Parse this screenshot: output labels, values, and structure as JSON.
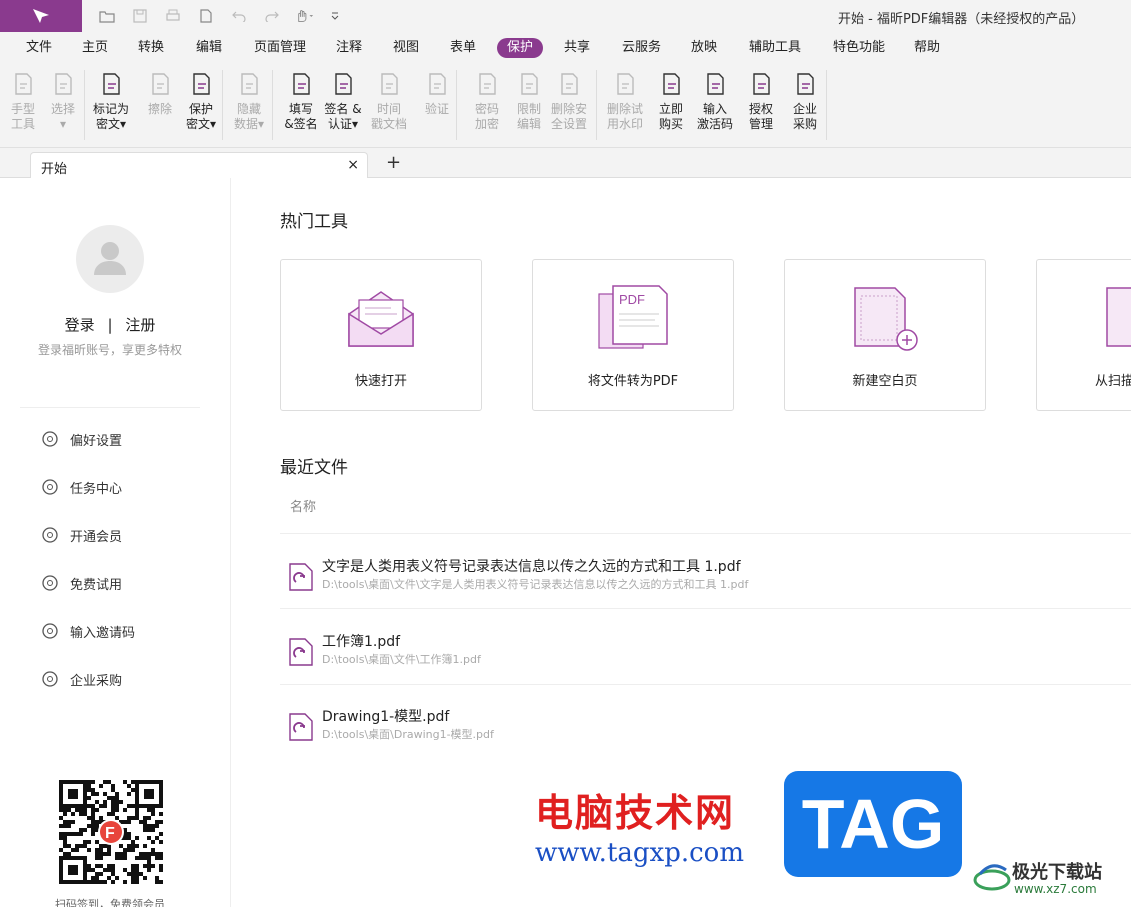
{
  "window": {
    "title": "开始 - 福昕PDF编辑器（未经授权的产品）"
  },
  "menu": [
    "文件",
    "主页",
    "转换",
    "编辑",
    "页面管理",
    "注释",
    "视图",
    "表单",
    "保护",
    "共享",
    "云服务",
    "放映",
    "辅助工具",
    "特色功能",
    "帮助"
  ],
  "menu_active": "保护",
  "ribbon": [
    {
      "label": "手型\n工具",
      "icon": "hand-icon",
      "enabled": false
    },
    {
      "label": "选择\n▾",
      "icon": "select-cursor-icon",
      "enabled": false
    },
    {
      "label": "标记为\n密文▾",
      "icon": "mark-redact-icon",
      "enabled": true
    },
    {
      "label": "擦除",
      "icon": "erase-icon",
      "enabled": false
    },
    {
      "label": "保护\n密文▾",
      "icon": "protect-redact-icon",
      "enabled": true
    },
    {
      "label": "隐藏\n数据▾",
      "icon": "hide-data-icon",
      "enabled": false
    },
    {
      "label": "填写\n&签名",
      "icon": "fill-sign-icon",
      "enabled": true
    },
    {
      "label": "签名 &\n认证▾",
      "icon": "sign-certify-icon",
      "enabled": true
    },
    {
      "label": "时间\n戳文档",
      "icon": "timestamp-icon",
      "enabled": false
    },
    {
      "label": "验证",
      "icon": "validate-icon",
      "enabled": false
    },
    {
      "label": "密码\n加密",
      "icon": "password-lock-icon",
      "enabled": false
    },
    {
      "label": "限制\n编辑",
      "icon": "restrict-edit-icon",
      "enabled": false
    },
    {
      "label": "删除安\n全设置",
      "icon": "remove-security-icon",
      "enabled": false
    },
    {
      "label": "删除试\n用水印",
      "icon": "remove-watermark-icon",
      "enabled": false
    },
    {
      "label": "立即\n购买",
      "icon": "cart-icon",
      "enabled": true
    },
    {
      "label": "输入\n激活码",
      "icon": "activation-key-icon",
      "enabled": true
    },
    {
      "label": "授权\n管理",
      "icon": "license-icon",
      "enabled": true
    },
    {
      "label": "企业\n采购",
      "icon": "bag-icon",
      "enabled": true
    }
  ],
  "tab": {
    "title": "开始",
    "close": "×",
    "add": "+"
  },
  "user": {
    "login": "登录",
    "sep": "|",
    "register": "注册",
    "subtitle": "登录福昕账号，享更多特权"
  },
  "sidebar": [
    {
      "label": "偏好设置",
      "icon": "preferences-icon"
    },
    {
      "label": "任务中心",
      "icon": "task-center-icon"
    },
    {
      "label": "开通会员",
      "icon": "membership-icon"
    },
    {
      "label": "免费试用",
      "icon": "free-trial-icon"
    },
    {
      "label": "输入邀请码",
      "icon": "invite-code-icon"
    },
    {
      "label": "企业采购",
      "icon": "enterprise-purchase-icon"
    }
  ],
  "qr_caption": "扫码签到，免费领会员",
  "hot_tools": {
    "title": "热门工具",
    "items": [
      {
        "label": "快速打开",
        "icon": "envelope-open-icon"
      },
      {
        "label": "将文件转为PDF",
        "icon": "convert-pdf-icon"
      },
      {
        "label": "新建空白页",
        "icon": "new-blank-page-icon"
      },
      {
        "label": "从扫描",
        "icon": "scan-icon"
      }
    ]
  },
  "recent": {
    "title": "最近文件",
    "column": "名称",
    "files": [
      {
        "name": "文字是人类用表义符号记录表达信息以传之久远的方式和工具 1.pdf",
        "path": "D:\\tools\\桌面\\文件\\文字是人类用表义符号记录表达信息以传之久远的方式和工具 1.pdf"
      },
      {
        "name": "工作簿1.pdf",
        "path": "D:\\tools\\桌面\\文件\\工作簿1.pdf"
      },
      {
        "name": "Drawing1-模型.pdf",
        "path": "D:\\tools\\桌面\\Drawing1-模型.pdf"
      }
    ]
  },
  "watermark": {
    "cn": "电脑技术网",
    "url": "www.tagxp.com",
    "tag": "TAG",
    "xz": "极光下载站",
    "xz_url": "www.xz7.com"
  },
  "colors": {
    "accent": "#8a3a8e",
    "toolbar_bg": "#f3f3f3"
  }
}
